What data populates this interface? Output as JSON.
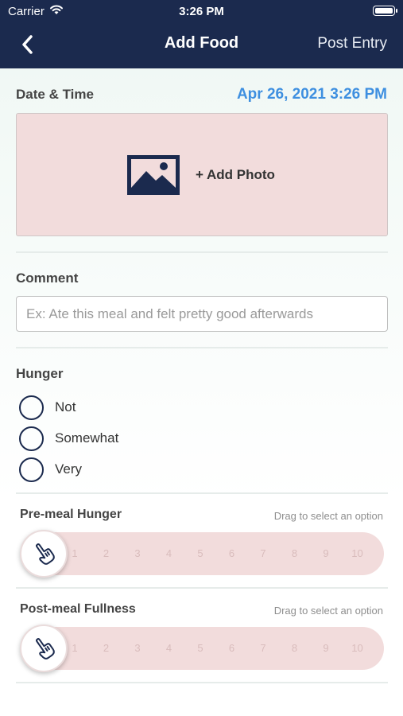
{
  "status_bar": {
    "carrier": "Carrier",
    "time": "3:26 PM"
  },
  "nav": {
    "title": "Add Food",
    "post_label": "Post Entry",
    "back_icon": "chevron-left-icon"
  },
  "date_time": {
    "label": "Date & Time",
    "value": "Apr 26, 2021 3:26 PM"
  },
  "photo": {
    "label": "+ Add Photo",
    "icon": "image-icon"
  },
  "comment": {
    "label": "Comment",
    "value": "",
    "placeholder": "Ex: Ate this meal and felt pretty good afterwards"
  },
  "hunger": {
    "label": "Hunger",
    "options": [
      {
        "label": "Not"
      },
      {
        "label": "Somewhat"
      },
      {
        "label": "Very"
      }
    ]
  },
  "pre_meal": {
    "label": "Pre-meal Hunger",
    "hint": "Drag to select an option",
    "ticks": [
      "1",
      "2",
      "3",
      "4",
      "5",
      "6",
      "7",
      "8",
      "9",
      "10"
    ]
  },
  "post_meal": {
    "label": "Post-meal Fullness",
    "hint": "Drag to select an option",
    "ticks": [
      "1",
      "2",
      "3",
      "4",
      "5",
      "6",
      "7",
      "8",
      "9",
      "10"
    ]
  },
  "colors": {
    "header_bg": "#1b2a4e",
    "accent": "#3e8fe0",
    "photo_bg": "#f2dcdc",
    "slider_bg": "#f2dcdc"
  }
}
